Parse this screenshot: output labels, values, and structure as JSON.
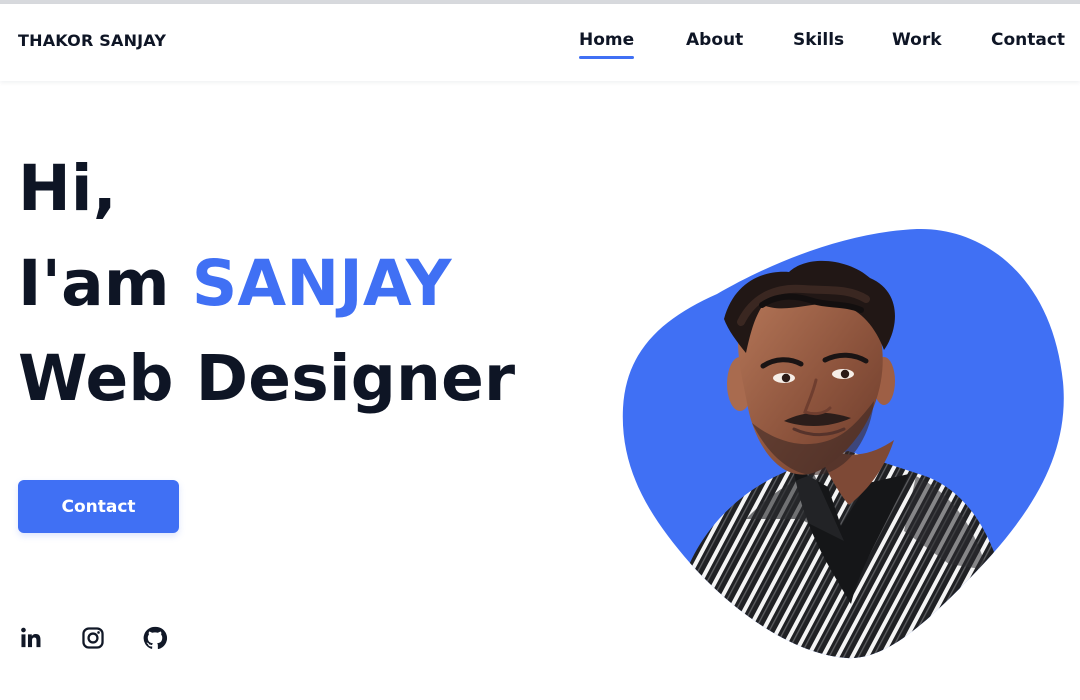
{
  "brand": {
    "name": "THAKOR SANJAY"
  },
  "nav": {
    "items": [
      {
        "label": "Home",
        "active": true
      },
      {
        "label": "About",
        "active": false
      },
      {
        "label": "Skills",
        "active": false
      },
      {
        "label": "Work",
        "active": false
      },
      {
        "label": "Contact",
        "active": false
      }
    ]
  },
  "hero": {
    "greeting": "Hi,",
    "intro_prefix": "I'am",
    "name": "SANJAY",
    "role": "Web Designer",
    "button_label": "Contact"
  },
  "social": [
    {
      "name": "LinkedIn",
      "icon": "linkedin-icon"
    },
    {
      "name": "Instagram",
      "icon": "instagram-icon"
    },
    {
      "name": "GitHub",
      "icon": "github-icon"
    }
  ],
  "profile": {
    "image_alt": "Profile photo",
    "blob_color": "#4070f4"
  },
  "colors": {
    "accent": "#4070f4",
    "text": "#0e1525",
    "background": "#ffffff",
    "topline": "#d7d9dd"
  }
}
